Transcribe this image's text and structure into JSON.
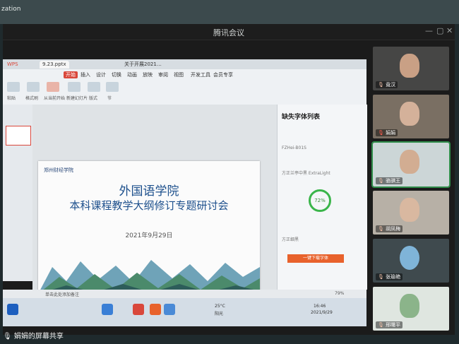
{
  "desktop": {
    "corner_text": "zation"
  },
  "meeting": {
    "title": "腾讯会议",
    "share_label": "娟娟的屏幕共享"
  },
  "wps": {
    "tabs": [
      "WPS",
      "9.23.pptx",
      "关于开展2021…"
    ],
    "menus": [
      "开始",
      "插入",
      "设计",
      "切换",
      "动画",
      "放映",
      "审阅",
      "视图",
      "开发工具",
      "会员专享"
    ],
    "ribbon_labels": [
      "粘贴",
      "格式刷",
      "从当前开始",
      "新建幻灯片",
      "版式",
      "节"
    ],
    "status": "单击此处添加备注",
    "zoom": "79%"
  },
  "slide": {
    "logo_text": "郑州财经学院",
    "title": "外国语学院",
    "subtitle": "本科课程教学大纲修订专题研讨会",
    "date": "2021年9月29日"
  },
  "panel": {
    "header": "缺失字体列表",
    "rows": [
      "FZHei-B01S",
      "方正兰亭中黑 ExtraLight",
      "方正细黑"
    ],
    "percent": "72%",
    "button": "一键下载字体"
  },
  "taskbar": {
    "weather_temp": "25°C",
    "weather_desc": "阳光",
    "clock_time": "16:46",
    "clock_date": "2021/9/29"
  },
  "participants": [
    {
      "name": "竟汉",
      "muted": false
    },
    {
      "name": "娟娟",
      "muted": true
    },
    {
      "name": "骆骐王",
      "muted": false
    },
    {
      "name": "胡凤梅",
      "muted": false
    },
    {
      "name": "张瑜艳",
      "muted": false
    },
    {
      "name": "邢曙平",
      "muted": false
    }
  ]
}
